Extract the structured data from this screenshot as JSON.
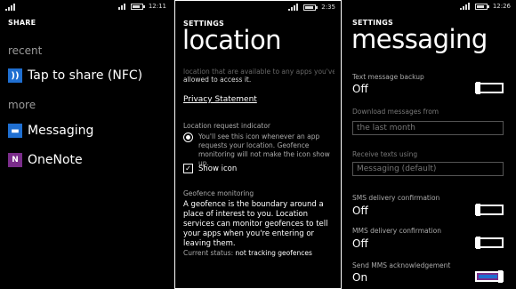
{
  "panel1": {
    "time": "12:11",
    "header": "SHARE",
    "recent_label": "recent",
    "recent_items": [
      {
        "label": "Tap to share (NFC)",
        "icon": "nfc-icon"
      }
    ],
    "more_label": "more",
    "more_items": [
      {
        "label": "Messaging",
        "icon": "messaging-icon"
      },
      {
        "label": "OneNote",
        "icon": "onenote-icon"
      }
    ]
  },
  "panel2": {
    "time": "2:35",
    "header": "SETTINGS",
    "title": "location",
    "faded_text": "location that are available to any apps you've",
    "intro_text": "allowed to access it.",
    "privacy_link": "Privacy Statement",
    "indicator_label": "Location request indicator",
    "indicator_desc": "You'll see this icon whenever an app requests your location. Geofence monitoring will not make the icon show up.",
    "show_icon_label": "Show icon",
    "geofence_label": "Geofence monitoring",
    "geofence_desc": "A geofence is the boundary around a place of interest to you. Location services can monitor geofences to tell your apps when you're entering or leaving them.",
    "status_label": "Current status:",
    "status_value": "not tracking geofences"
  },
  "panel3": {
    "time": "12:26",
    "header": "SETTINGS",
    "title": "messaging",
    "backup_label": "Text message backup",
    "backup_value": "Off",
    "download_label": "Download messages from",
    "download_value": "the last month",
    "receive_label": "Receive texts using",
    "receive_value": "Messaging (default)",
    "sms_label": "SMS delivery confirmation",
    "sms_value": "Off",
    "mms_label": "MMS delivery confirmation",
    "mms_value": "Off",
    "mmsack_label": "Send MMS acknowledgement",
    "mmsack_value": "On"
  },
  "colors": {
    "accent": "#1f6fd1",
    "onenote": "#7a2d8a"
  }
}
